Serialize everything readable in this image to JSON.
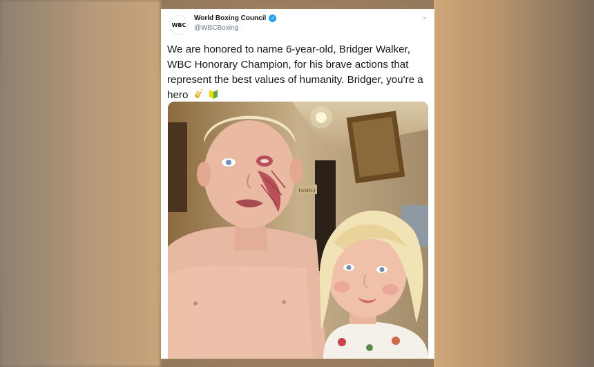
{
  "tweet": {
    "account_name": "World Boxing Council",
    "handle": "@WBCBoxing",
    "avatar_text": "WBC",
    "text": "We are honored to name 6-year-old, Bridger Walker, WBC Honorary Champion, for his brave actions that represent the best values of humanity. Bridger, you're a hero",
    "emojis": [
      "clapping-hands-emoji",
      "beginner-symbol-emoji"
    ],
    "menu_icon": "chevron-down-icon",
    "verified_icon": "verified-badge-icon"
  },
  "photo": {
    "sign_text": "FAMILY"
  },
  "colors": {
    "verified": "#1da1f2",
    "text": "#14171a",
    "secondary": "#657786"
  }
}
